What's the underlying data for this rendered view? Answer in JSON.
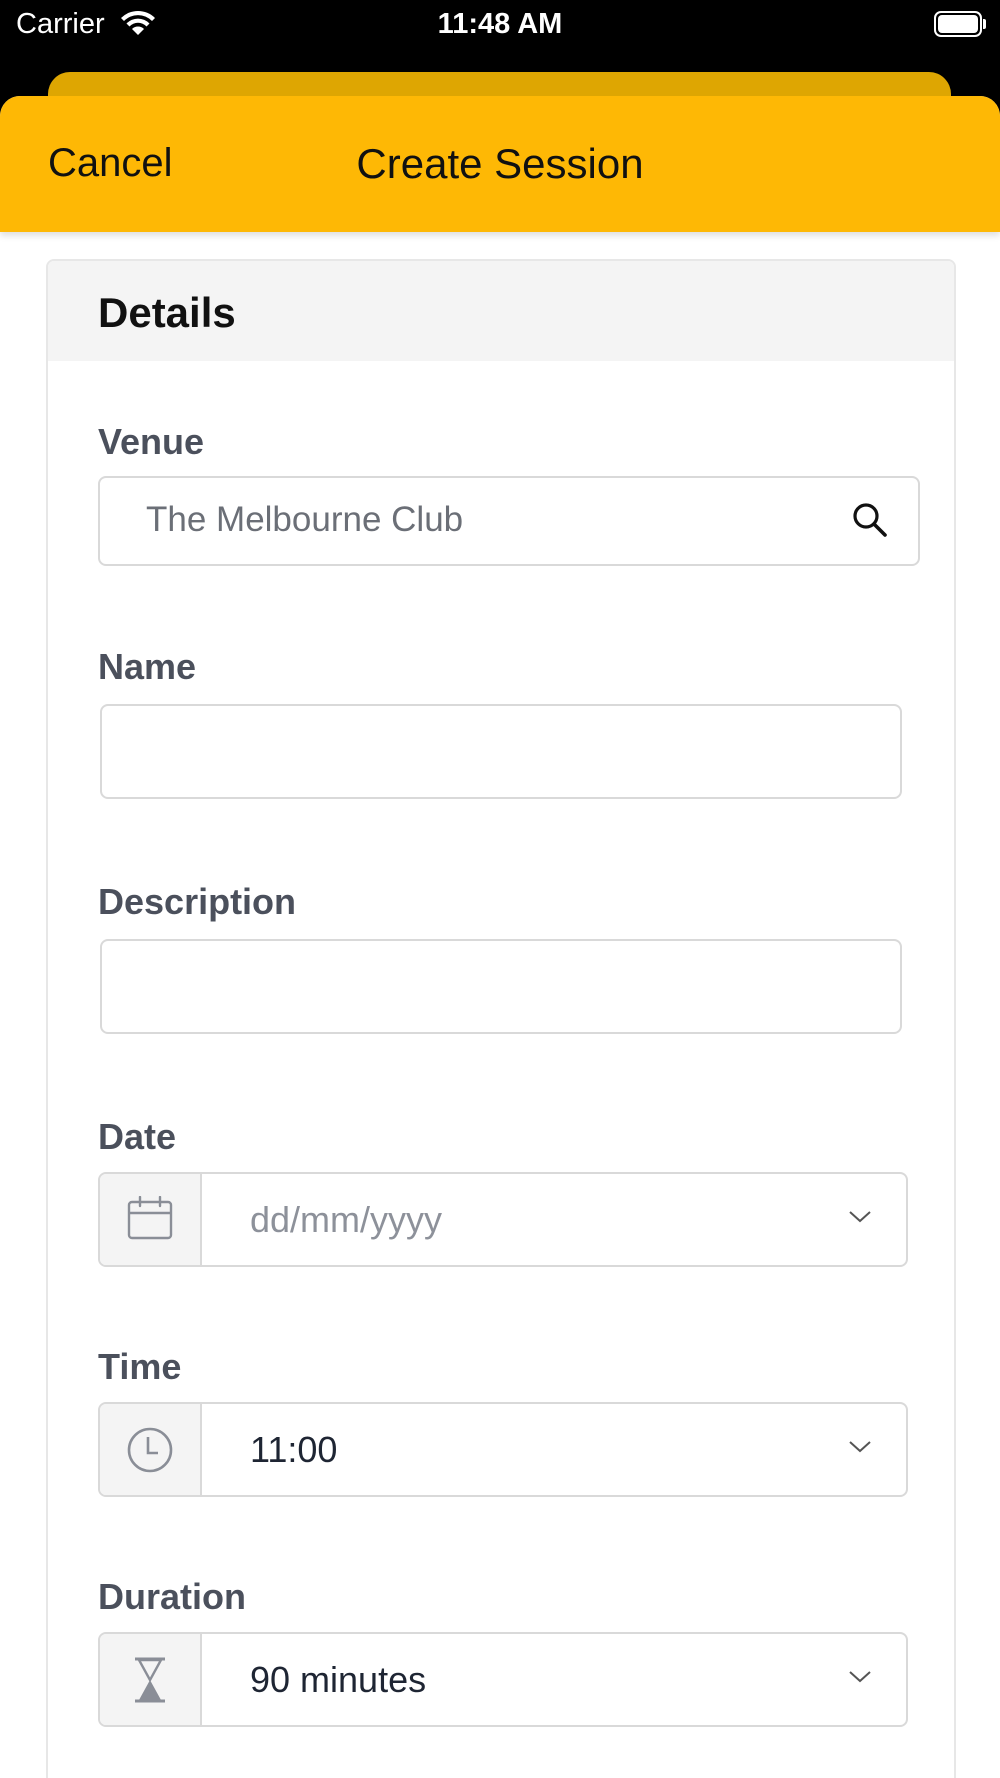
{
  "status_bar": {
    "carrier": "Carrier",
    "time": "11:48 AM"
  },
  "nav": {
    "cancel_label": "Cancel",
    "title": "Create Session"
  },
  "colors": {
    "nav_bar": "#FEB805",
    "back_sheet": "#DEA602"
  },
  "details": {
    "section_title": "Details",
    "venue": {
      "label": "Venue",
      "value": "The Melbourne Club",
      "icon": "search-icon"
    },
    "name": {
      "label": "Name",
      "value": ""
    },
    "description": {
      "label": "Description",
      "value": ""
    },
    "date": {
      "label": "Date",
      "placeholder": "dd/mm/yyyy",
      "icon": "calendar-icon"
    },
    "time": {
      "label": "Time",
      "value": "11:00",
      "icon": "clock-icon"
    },
    "duration": {
      "label": "Duration",
      "value": "90 minutes",
      "icon": "hourglass-icon"
    }
  }
}
